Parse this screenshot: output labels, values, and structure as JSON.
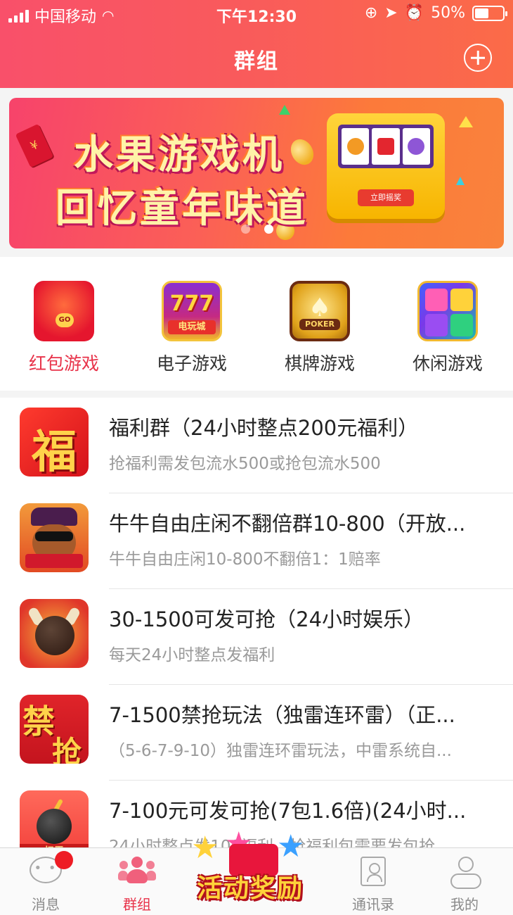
{
  "status_bar": {
    "carrier": "中国移动",
    "time": "下午12:30",
    "battery_percent": "50%",
    "battery_level": 0.5
  },
  "header": {
    "title": "群组"
  },
  "banner": {
    "line1": "水果游戏机",
    "line2": "回忆童年味道",
    "machine_button": "立即摇奖",
    "active_slide": 2,
    "slide_count": 2
  },
  "categories": [
    {
      "label": "红包游戏",
      "icon": "red-envelope-icon",
      "active": true
    },
    {
      "label": "电子游戏",
      "icon": "slot-777-icon",
      "icon_text": "777",
      "icon_caption": "电玩城"
    },
    {
      "label": "棋牌游戏",
      "icon": "poker-chip-icon",
      "icon_text": "POKER"
    },
    {
      "label": "休闲游戏",
      "icon": "gem-puzzle-icon"
    }
  ],
  "groups": [
    {
      "name": "福利群（24小时整点200元福利）",
      "subtitle": "抢福利需发包流水500或抢包流水500",
      "avatar_text": "福"
    },
    {
      "name": "牛牛自由庄闲不翻倍群10-800（开放...",
      "subtitle": "牛牛自由庄闲10-800不翻倍1：1赔率"
    },
    {
      "name": "30-1500可发可抢（24小时娱乐）",
      "subtitle": "每天24小时整点发福利"
    },
    {
      "name": "7-1500禁抢玩法（独雷连环雷）（正...",
      "subtitle": "（5-6-7-9-10）独雷连环雷玩法，中雷系统自...",
      "avatar_text_1": "禁",
      "avatar_text_2": "抢"
    },
    {
      "name": "7-100元可发可抢(7包1.6倍)(24小时...",
      "subtitle": "24小时整点发100福利，抢福利包需要发包抢",
      "avatar_text": "扫雷"
    }
  ],
  "tabbar": {
    "messages": "消息",
    "groups": "群组",
    "promo": "活动奖励",
    "contacts": "通讯录",
    "me": "我的"
  },
  "colors": {
    "accent": "#e8334a",
    "header_gradient_start": "#f9506a",
    "header_gradient_end": "#fb6b48"
  }
}
